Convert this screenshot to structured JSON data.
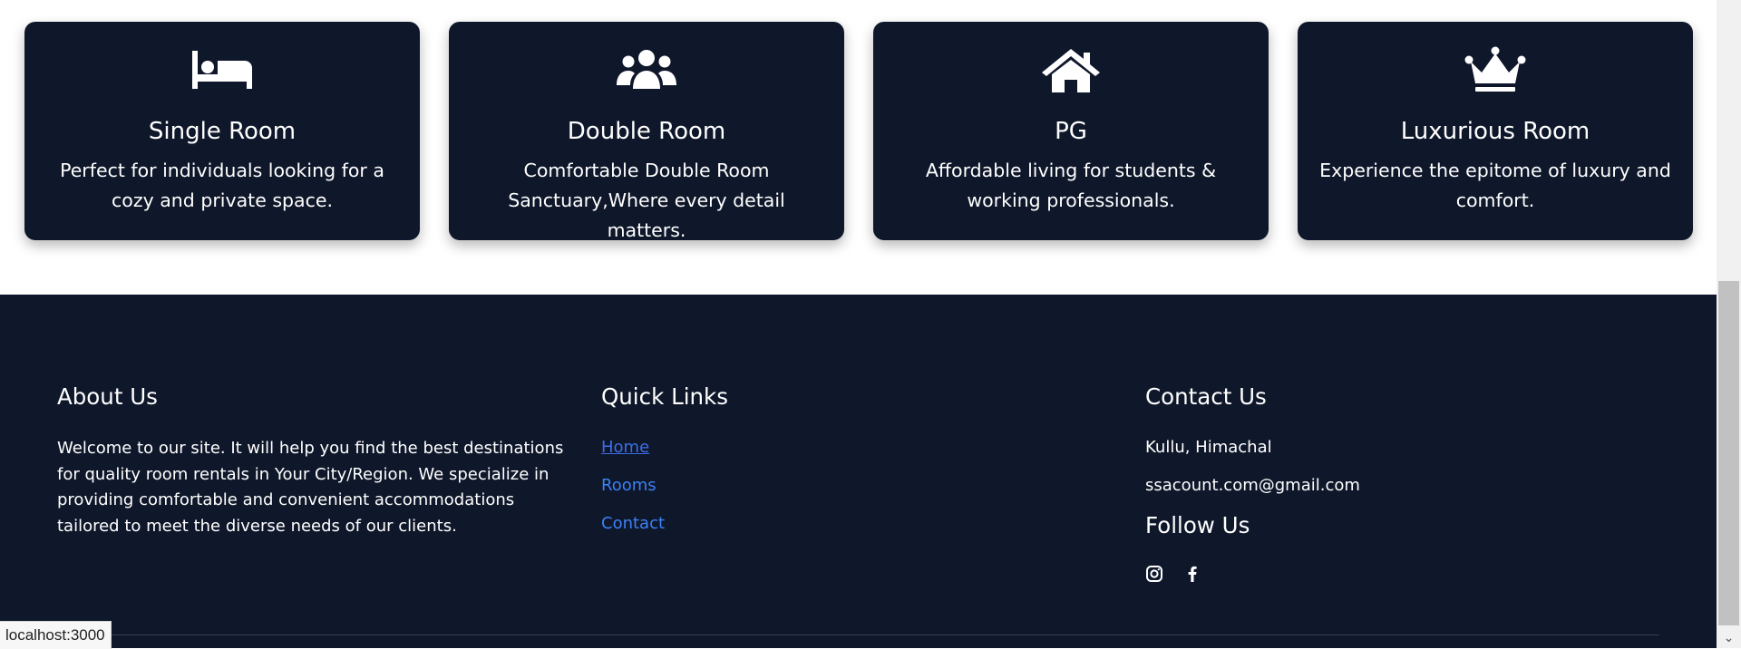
{
  "rooms": [
    {
      "icon": "bed-icon",
      "title": "Single Room",
      "description": "Perfect for individuals looking for a cozy and private space."
    },
    {
      "icon": "users-icon",
      "title": "Double Room",
      "description": "Comfortable Double Room Sanctuary,Where every detail matters."
    },
    {
      "icon": "house-icon",
      "title": "PG",
      "description": "Affordable living for students & working professionals."
    },
    {
      "icon": "crown-icon",
      "title": "Luxurious Room",
      "description": "Experience the epitome of luxury and comfort."
    }
  ],
  "footer": {
    "about": {
      "heading": "About Us",
      "text": "Welcome to our site. It will help you find the best destinations for quality room rentals in Your City/Region. We specialize in providing comfortable and convenient accommodations tailored to meet the diverse needs of our clients."
    },
    "quick_links": {
      "heading": "Quick Links",
      "links": [
        "Home",
        "Rooms",
        "Contact"
      ]
    },
    "contact": {
      "heading": "Contact Us",
      "location": "Kullu, Himachal",
      "email": "ssacount.com@gmail.com",
      "follow_heading": "Follow Us",
      "socials": [
        "instagram-icon",
        "facebook-icon"
      ]
    }
  },
  "status_bar": {
    "url": "localhost:3000"
  },
  "colors": {
    "card_bg": "#0f172a",
    "footer_bg": "#0f172a",
    "link": "#3b82f6",
    "text": "#ffffff"
  }
}
